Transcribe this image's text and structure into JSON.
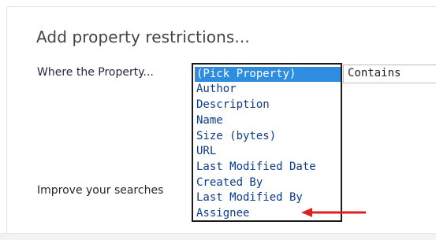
{
  "dialog": {
    "title": "Add property restrictions...",
    "where_label": "Where the Property...",
    "improve_label": "Improve your searches"
  },
  "property_list": {
    "selected_index": 0,
    "options": [
      "(Pick Property)",
      "Author",
      "Description",
      "Name",
      "Size (bytes)",
      "URL",
      "Last Modified Date",
      "Created By",
      "Last Modified By",
      "Assignee"
    ]
  },
  "operator": {
    "value": "Contains"
  },
  "colors": {
    "selection": "#2f8de0",
    "option_text": "#0d3b8a",
    "annotation_arrow": "#e0201e"
  }
}
